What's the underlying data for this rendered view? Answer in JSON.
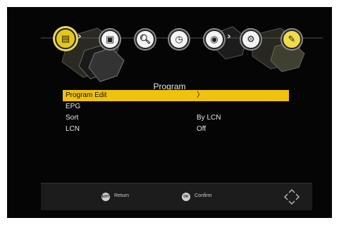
{
  "screen": {
    "title": "Program"
  },
  "iconbar": {
    "items": [
      {
        "name": "program-icon",
        "glyph": "▤",
        "active": true
      },
      {
        "name": "picture-icon",
        "glyph": "▣",
        "active": false
      },
      {
        "name": "search-icon",
        "glyph": "🔍︎",
        "active": false
      },
      {
        "name": "time-icon",
        "glyph": "◷",
        "active": false
      },
      {
        "name": "language-icon",
        "glyph": "◉",
        "active": false
      },
      {
        "name": "settings-icon",
        "glyph": "⚙",
        "active": false
      },
      {
        "name": "tools-icon",
        "glyph": "✎",
        "active": false
      }
    ],
    "accent": "#f0c20d"
  },
  "menu": {
    "items": [
      {
        "label": "Program Edit",
        "value": "〉",
        "selected": true
      },
      {
        "label": "EPG",
        "value": "",
        "selected": false
      },
      {
        "label": "Sort",
        "value": "By LCN",
        "selected": false
      },
      {
        "label": "LCN",
        "value": "Off",
        "selected": false
      }
    ]
  },
  "footer": {
    "return_key": "EXIT",
    "return_label": "Return",
    "confirm_key": "OK",
    "confirm_label": "Confirm"
  }
}
